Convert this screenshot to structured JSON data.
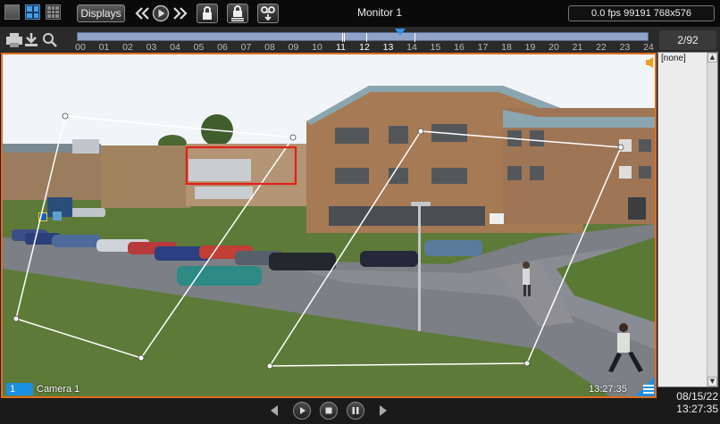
{
  "toolbar": {
    "displays_label": "Displays",
    "monitor_title": "Monitor 1",
    "status_text": "0.0 fps  99191 768x576",
    "icons": [
      "layout-1x1-icon",
      "layout-2x2-icon",
      "layout-3x3-icon",
      "rewind-icon",
      "play-icon",
      "fast-forward-icon",
      "lock-icon",
      "lock-all-icon",
      "tape-archive-icon"
    ]
  },
  "timeline": {
    "hours": [
      "00",
      "01",
      "02",
      "03",
      "04",
      "05",
      "06",
      "07",
      "08",
      "09",
      "10",
      "11",
      "12",
      "13",
      "14",
      "15",
      "16",
      "17",
      "18",
      "19",
      "20",
      "21",
      "22",
      "23",
      "24"
    ],
    "bright_hours": [
      "11",
      "12",
      "13"
    ],
    "cursor_hour": 13.46,
    "icons": [
      "print-icon",
      "download-icon",
      "zoom-icon"
    ]
  },
  "counter": "2/92",
  "camera": {
    "number": "1",
    "name": "Camera 1",
    "timestamp": "13:27:35"
  },
  "side_panel": {
    "items": [
      "[none]"
    ]
  },
  "playback": {
    "buttons": [
      "step-back-icon",
      "play-icon",
      "stop-icon",
      "pause-icon",
      "step-forward-icon"
    ]
  },
  "clock": {
    "date": "08/15/22",
    "time": "13:27:35"
  },
  "colors": {
    "accent": "#1d8fe0",
    "frame_border": "#e06d1d",
    "detection_box": "#e0201a"
  }
}
